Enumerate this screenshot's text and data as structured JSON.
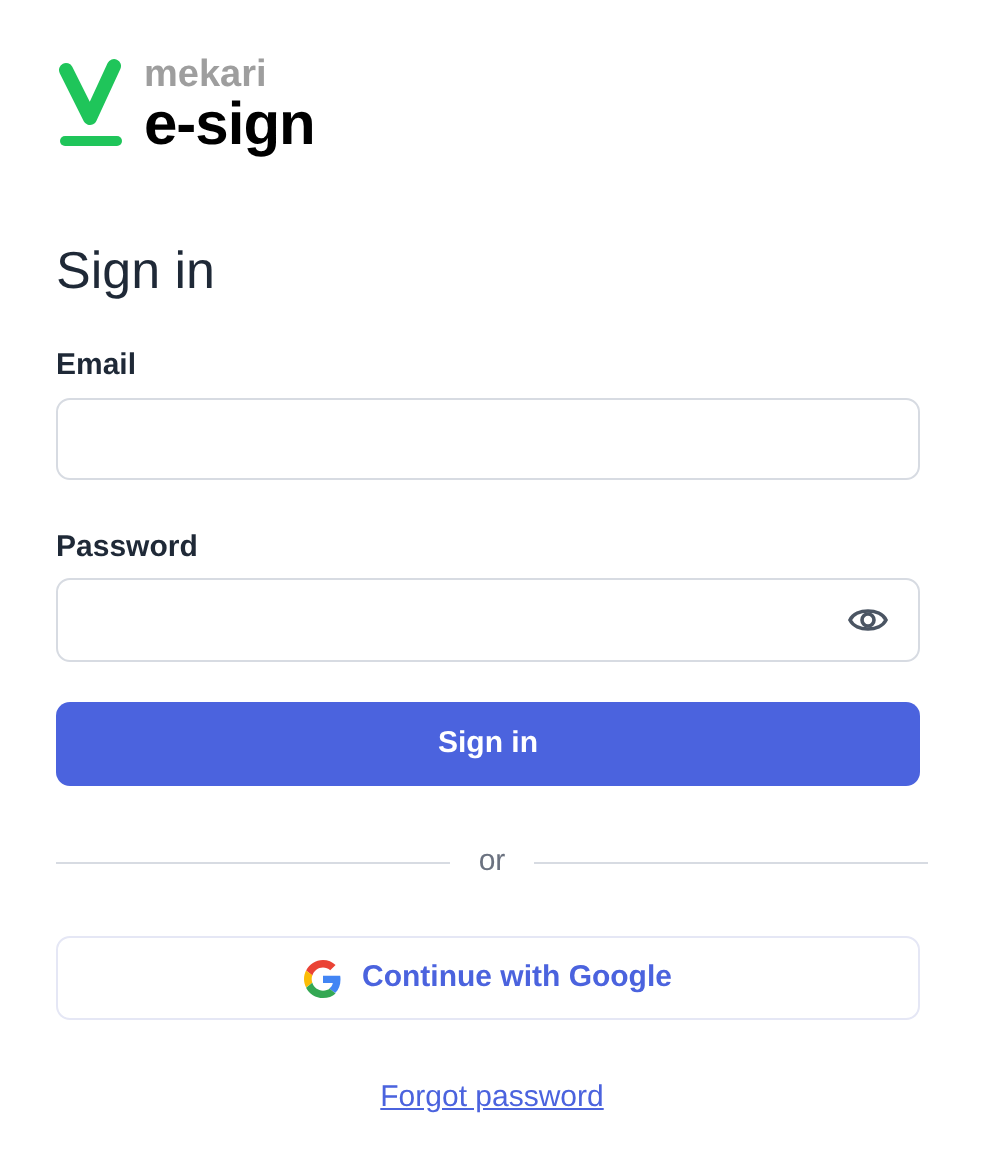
{
  "logo": {
    "brand": "mekari",
    "product": "e-sign"
  },
  "heading": "Sign in",
  "email": {
    "label": "Email"
  },
  "password": {
    "label": "Password"
  },
  "submit": "Sign in",
  "divider": "or",
  "google_button": "Continue with Google",
  "forgot_link": "Forgot password"
}
